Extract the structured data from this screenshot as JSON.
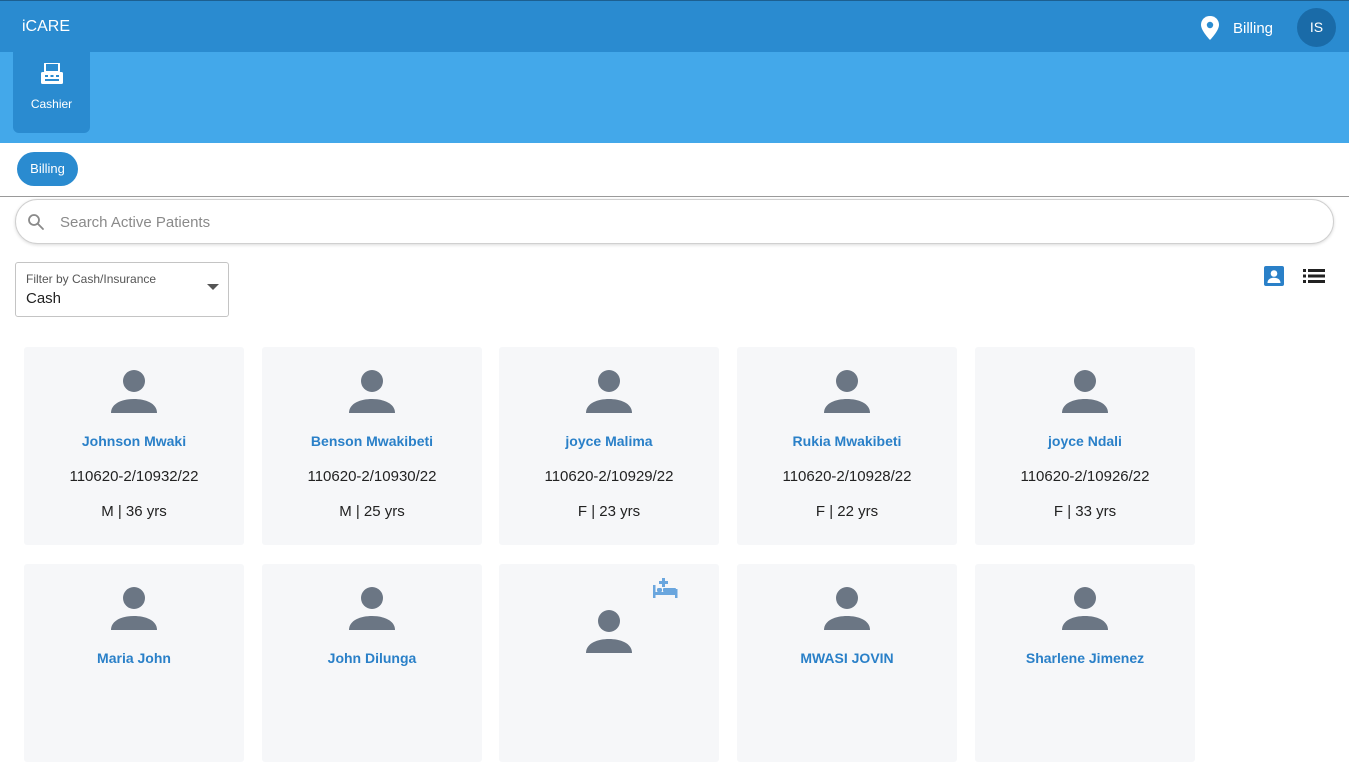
{
  "header": {
    "app_title": "iCARE",
    "location_icon": "location-pin-icon",
    "location_label": "Billing",
    "user_initials": "IS"
  },
  "apps": [
    {
      "label": "Cashier",
      "icon": "cashier-register-icon"
    }
  ],
  "tabs": [
    {
      "label": "Billing",
      "active": true
    }
  ],
  "search": {
    "placeholder": "Search Active Patients",
    "value": "",
    "icon": "search-icon"
  },
  "filter": {
    "label": "Filter by Cash/Insurance",
    "selected": "Cash"
  },
  "view_toggle": {
    "card_view_icon": "account-box-icon",
    "list_view_icon": "list-icon"
  },
  "patients": [
    {
      "name": "Johnson Mwaki",
      "id": "110620-2/10932/22",
      "demographics": "M | 36 yrs"
    },
    {
      "name": "Benson Mwakibeti",
      "id": "110620-2/10930/22",
      "demographics": "M | 25 yrs"
    },
    {
      "name": "joyce Malima",
      "id": "110620-2/10929/22",
      "demographics": "F | 23 yrs"
    },
    {
      "name": "Rukia Mwakibeti",
      "id": "110620-2/10928/22",
      "demographics": "F | 22 yrs"
    },
    {
      "name": "joyce Ndali",
      "id": "110620-2/10926/22",
      "demographics": "F | 33 yrs"
    },
    {
      "name": "Maria John",
      "id": "",
      "demographics": ""
    },
    {
      "name": "John Dilunga",
      "id": "",
      "demographics": ""
    },
    {
      "name": "",
      "id": "",
      "demographics": "",
      "admitted_icon": "hospital-bed-icon"
    },
    {
      "name": "MWASI JOVIN",
      "id": "",
      "demographics": ""
    },
    {
      "name": "Sharlene Jimenez",
      "id": "",
      "demographics": ""
    }
  ],
  "colors": {
    "topbar": "#2a8bd0",
    "appbar": "#43a8ea",
    "accent": "#2a80c8",
    "card_bg": "#f6f7f9",
    "avatar_grey": "#6b7684"
  }
}
